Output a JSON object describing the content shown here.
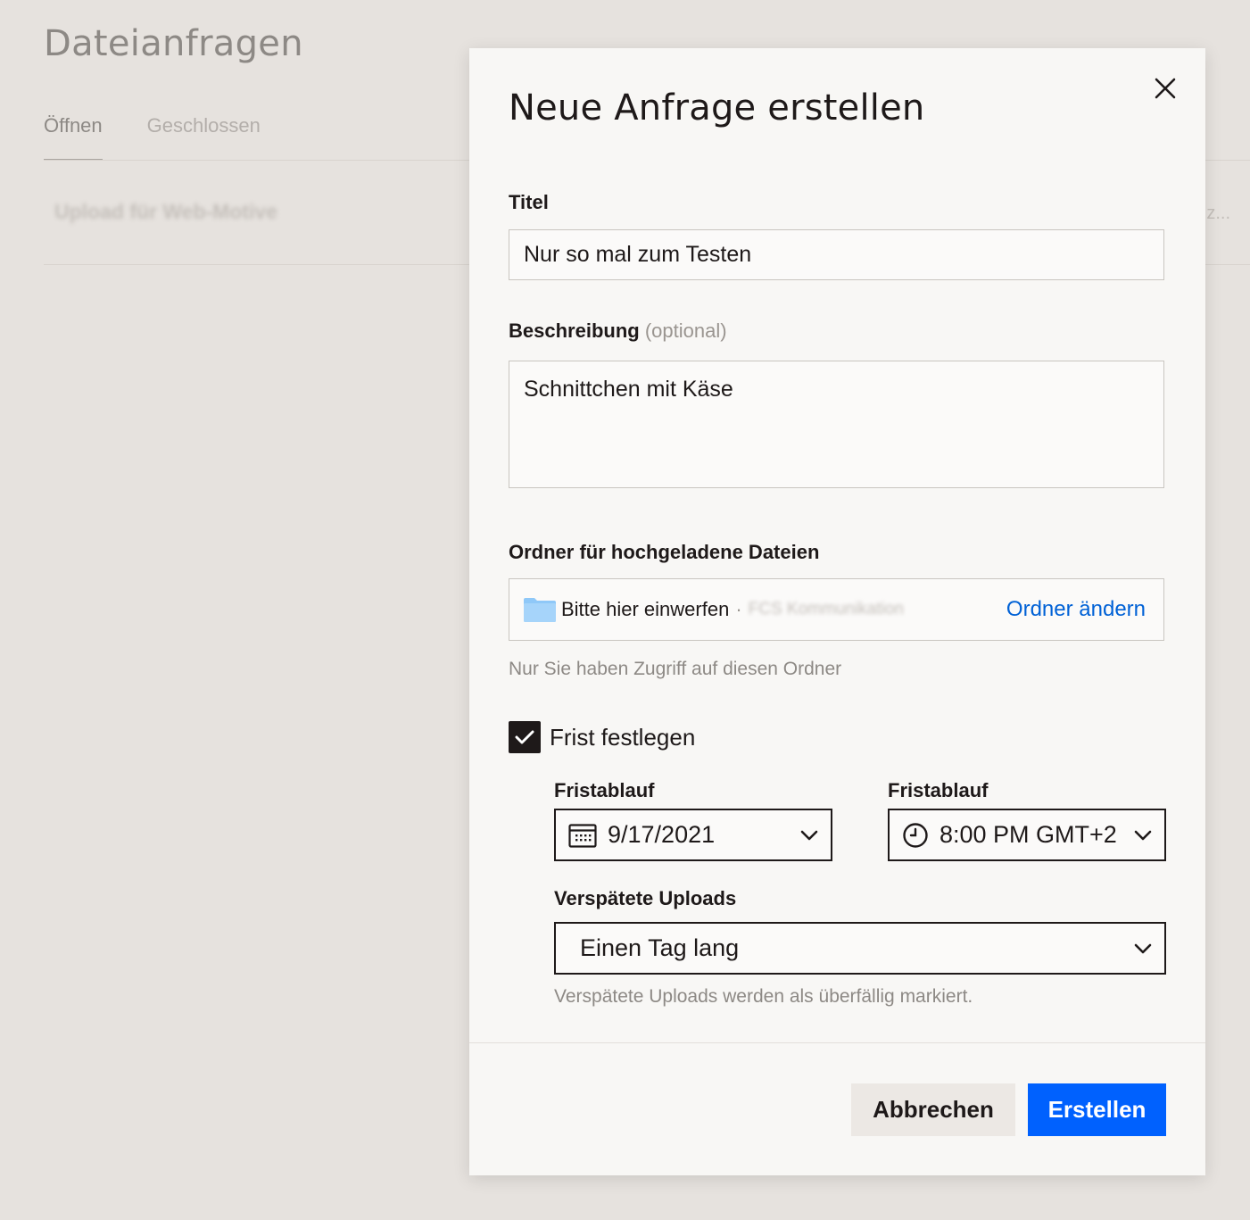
{
  "page": {
    "title": "Dateianfragen",
    "tabs": [
      {
        "label": "Öffnen",
        "active": true
      },
      {
        "label": "Geschlossen",
        "active": false
      }
    ],
    "row": {
      "title": "Upload für Web-Motive",
      "truncated_right": "z..."
    }
  },
  "modal": {
    "title": "Neue Anfrage erstellen",
    "close_icon": "close-icon",
    "title_field": {
      "label": "Titel",
      "value": "Nur so mal zum Testen"
    },
    "description_field": {
      "label": "Beschreibung",
      "optional": "(optional)",
      "value": "Schnittchen mit Käse"
    },
    "folder": {
      "label": "Ordner für hochgeladene Dateien",
      "name": "Bitte hier einwerfen",
      "separator": "·",
      "path": "FCS Kommunikation",
      "change_label": "Ordner ändern",
      "hint": "Nur Sie haben Zugriff auf diesen Ordner",
      "icon_color": "#8fc8f8"
    },
    "deadline": {
      "checkbox_label": "Frist festlegen",
      "checked": true,
      "date_label": "Fristablauf",
      "date_value": "9/17/2021",
      "time_label": "Fristablauf",
      "time_value": "8:00 PM GMT+2"
    },
    "late_uploads": {
      "label": "Verspätete Uploads",
      "value": "Einen Tag lang",
      "hint": "Verspätete Uploads werden als überfällig markiert."
    },
    "buttons": {
      "cancel": "Abbrechen",
      "create": "Erstellen"
    }
  },
  "colors": {
    "accent": "#0061fe",
    "link": "#0061d6",
    "background": "#e6e2de",
    "modal_bg": "#f8f7f5"
  }
}
